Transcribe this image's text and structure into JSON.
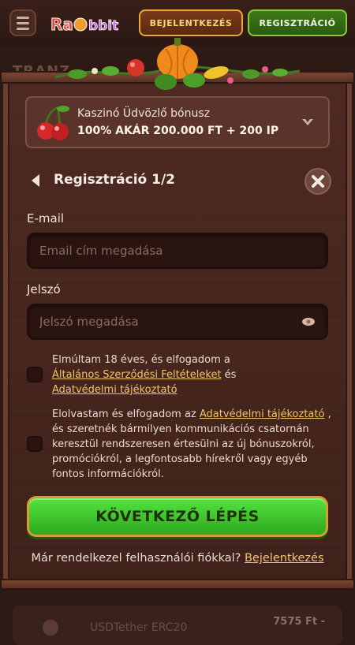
{
  "header": {
    "logo_text": "Rabbit",
    "login_label": "BEJELENTKEZÉS",
    "register_label": "REGISZTRÁCIÓ"
  },
  "background": {
    "title": "TRANZ",
    "row_name": "USDTether ERC20",
    "row_amount": "7575 Ft -"
  },
  "bonus": {
    "title": "Kaszinó Üdvözlő bónusz",
    "value": "100% AKÁR 200.000 FT + 200 IP"
  },
  "registration": {
    "title": "Regisztráció 1/2",
    "email_label": "E-mail",
    "email_placeholder": "Email cím megadása",
    "email_value": "",
    "password_label": "Jelszó",
    "password_placeholder": "Jelszó megadása",
    "password_value": ""
  },
  "consent1": {
    "text1": "Elmúltam 18 éves, és elfogadom a",
    "link1": "Általános Szerződési Feltételeket",
    "text2": " és",
    "link2": "Adatvédelmi tájékoztató"
  },
  "consent2": {
    "text1": "Elolvastam és elfogadom az ",
    "link1": "Adatvédelmi tájékoztató",
    "text2": " , és szeretnék bármilyen kommunikációs csatornán keresztül rendszeresen értesülni az új bónuszokról, promóciókról, a legfontosabb hírekről vagy egyéb fontos információkról."
  },
  "actions": {
    "next_label": "KÖVETKEZŐ LÉPÉS",
    "footer_text": "Már rendelkezel felhasználói fiókkal? ",
    "footer_link": "Bejelentkezés"
  },
  "icons": {
    "menu": "menu-icon",
    "back": "chevron-left-icon",
    "close": "close-icon",
    "chevron": "chevron-down-icon",
    "eye": "eye-icon",
    "cherry": "cherry-icon"
  },
  "colors": {
    "accent_green": "#3fc22a",
    "link_gold": "#f0c56b",
    "wood": "#4d2a22"
  }
}
